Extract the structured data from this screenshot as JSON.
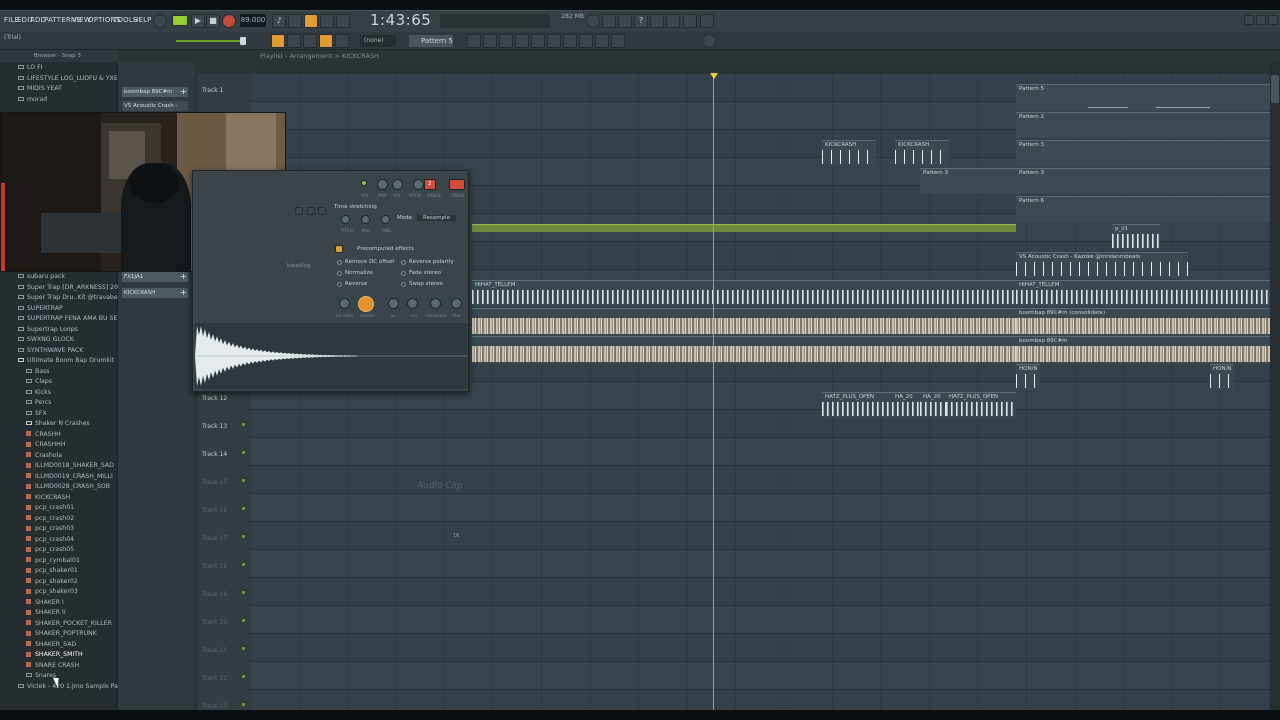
{
  "menu": [
    "FILE",
    "EDIT",
    "ADD",
    "PATTERNS",
    "VIEW",
    "OPTIONS",
    "TOOLS",
    "HELP"
  ],
  "transport": {
    "tempo": "89.000",
    "time": "1:43:65",
    "cpu": "282 MB",
    "trial": "(Trial)"
  },
  "toolbar": {
    "none_box": "(none)",
    "pattern": "Pattern 5"
  },
  "browser": {
    "title": "Browser - Snap 3",
    "items": [
      {
        "label": "LO FI",
        "type": "folder"
      },
      {
        "label": "LIFESTYLE LOG_LUDFU & YXELLS",
        "type": "folder"
      },
      {
        "label": "MIDIS YEAT",
        "type": "folder"
      },
      {
        "label": "morad",
        "type": "folder"
      },
      {
        "label": "subaru pack",
        "type": "folder"
      },
      {
        "label": "Super Trap [DR_ARKNESS] 2023",
        "type": "folder"
      },
      {
        "label": "Super Trap Dru..Kit @travabeats",
        "type": "folder"
      },
      {
        "label": "SUPERTRAP",
        "type": "folder"
      },
      {
        "label": "SUPERTRAP FENA AMA BU SEFER",
        "type": "folder"
      },
      {
        "label": "Supertrap Loops",
        "type": "folder"
      },
      {
        "label": "SWXNG GLOCK",
        "type": "folder"
      },
      {
        "label": "SYNTHWAVE PACK",
        "type": "folder"
      },
      {
        "label": "Ultimate Boom Bap Drumkit",
        "type": "open"
      },
      {
        "label": "Bass",
        "type": "folder"
      },
      {
        "label": "Claps",
        "type": "folder"
      },
      {
        "label": "Kicks",
        "type": "folder"
      },
      {
        "label": "Percs",
        "type": "folder"
      },
      {
        "label": "SFX",
        "type": "folder"
      },
      {
        "label": "Shaker N Crashes",
        "type": "open"
      },
      {
        "label": "CRASHH",
        "type": "file"
      },
      {
        "label": "CRASHHH",
        "type": "file"
      },
      {
        "label": "Crashola",
        "type": "file"
      },
      {
        "label": "ILLMD0018_SHAKER_SAD",
        "type": "file"
      },
      {
        "label": "ILLMD0019_CRASH_MILLI",
        "type": "file"
      },
      {
        "label": "ILLMD0028_CRASH_SOB",
        "type": "file"
      },
      {
        "label": "KICKCRASH",
        "type": "file"
      },
      {
        "label": "pcp_crash01",
        "type": "file"
      },
      {
        "label": "pcp_crash02",
        "type": "file"
      },
      {
        "label": "pcp_crash03",
        "type": "file"
      },
      {
        "label": "pcp_crash04",
        "type": "file"
      },
      {
        "label": "pcp_crash05",
        "type": "file"
      },
      {
        "label": "pcp_cymbal01",
        "type": "file"
      },
      {
        "label": "pcp_shaker01",
        "type": "file"
      },
      {
        "label": "pcp_shaker02",
        "type": "file"
      },
      {
        "label": "pcp_shaker03",
        "type": "file"
      },
      {
        "label": "SHAKER I",
        "type": "file"
      },
      {
        "label": "SHAKER II",
        "type": "file"
      },
      {
        "label": "SHAKER_POCKET_KILLER",
        "type": "file"
      },
      {
        "label": "SHAKER_POPTRUNK",
        "type": "file"
      },
      {
        "label": "SHAKER_SAD",
        "type": "file"
      },
      {
        "label": "SHAKER_SMITH",
        "type": "file"
      },
      {
        "label": "SNARE CRASH",
        "type": "file"
      },
      {
        "label": "Snares",
        "type": "folder"
      },
      {
        "label": "Victek - 420 1.Jmo Sample Pack",
        "type": "folder"
      }
    ]
  },
  "rack": [
    "boombap 89C#m",
    "VS Acoustic Crash - K...",
    "FX1JA1",
    "KICKCRASH"
  ],
  "playlist": {
    "title": "Playlist - Arrangement > KICKCRASH",
    "tracks": [
      "Track 1",
      "Track 12",
      "Track 13",
      "Track 14",
      "Track 15",
      "Track 16",
      "Track 17",
      "Track 18",
      "Track 19",
      "Track 20",
      "Track 21",
      "Track 22",
      "Track 23"
    ],
    "ruler": [
      "",
      "",
      "",
      "",
      "",
      "",
      ""
    ],
    "clips": {
      "p5": "Pattern 5",
      "p2": "Pattern 2",
      "p3a": "Pattern 3",
      "p3b": "Pattern 3",
      "p3c": "Pattern 3",
      "p6": "Pattern 6",
      "kc1": "KICKCRASH",
      "kc2": "KICKCRASH",
      "vs": "VS Acoustic Crash - Kazoke @mrslanmbeats",
      "hihat1": "HIHAT_TELLEM",
      "hihat2": "HIHAT_TELLEM",
      "boom1": "boombap 89C#m (consolidate)",
      "boom2": "boombap 89C#m",
      "hon1": "HON/N",
      "hon2": "HON/N",
      "hatz1": "HATZ_PLUS_OPEN",
      "hatz2": "HA_20",
      "hatz3": "HA_20",
      "hatz4": "HATZ_PLUS_OPEN",
      "pcp": "p_01"
    }
  },
  "plugin": {
    "time_stretching": "Time stretching",
    "mode_label": "Mode",
    "mode_value": "Resample",
    "knob_labels": [
      "PITCH",
      "MUL",
      "TIME"
    ],
    "precomputed": "Precomputed effects",
    "effects_left": [
      "Remove DC offset",
      "Normalize",
      "Reverse"
    ],
    "effects_right": [
      "Reverse polarity",
      "Fade stereo",
      "Swap stereo"
    ],
    "bottom_knobs": [
      "INT START",
      "LENGTH",
      "IN",
      "OUT",
      "CROSSFADE",
      "TRIM"
    ],
    "top_labels": [
      "VOL",
      "PAN",
      "VOL",
      "PITCH",
      "RANGE",
      "TRACK"
    ],
    "track_num": "2",
    "left_label": "bleeding",
    "watermark": "Audio Clip",
    "corner": "16"
  },
  "colors": {
    "accent_orange": "#e39b34",
    "accent_green": "#9acd32",
    "playhead_marker": "#e8d53b"
  }
}
